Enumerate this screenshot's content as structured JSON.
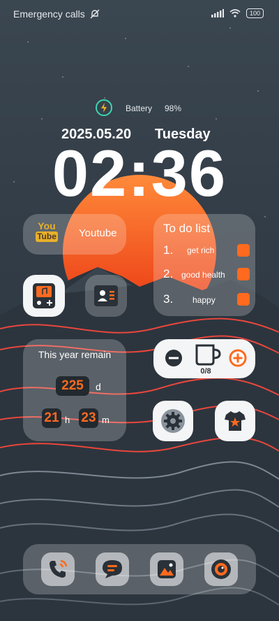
{
  "status": {
    "left_text": "Emergency calls",
    "battery": "100"
  },
  "battery_widget": {
    "label": "Battery",
    "percent": "98%"
  },
  "clock": {
    "date": "2025.05.20",
    "weekday": "Tuesday",
    "time": "02:36"
  },
  "youtube": {
    "logo_top": "You",
    "logo_bottom": "Tube",
    "label": "Youtube"
  },
  "todo": {
    "title": "To do list",
    "items": [
      {
        "num": "1.",
        "text": "get rich"
      },
      {
        "num": "2.",
        "text": "good health"
      },
      {
        "num": "3.",
        "text": "happy"
      }
    ]
  },
  "year_remain": {
    "title": "This year remain",
    "days": "225",
    "days_unit": "d",
    "hours": "21",
    "hours_unit": "h",
    "minutes": "23",
    "minutes_unit": "m"
  },
  "water": {
    "count": "0/8"
  },
  "colors": {
    "accent": "#ff6a1e",
    "sun_top": "#ff7a2a",
    "sun_bottom": "#ee3a14",
    "dark_pill": "#22292f"
  },
  "dock": {
    "icons": [
      "phone-icon",
      "messages-icon",
      "gallery-icon",
      "camera-icon"
    ]
  }
}
